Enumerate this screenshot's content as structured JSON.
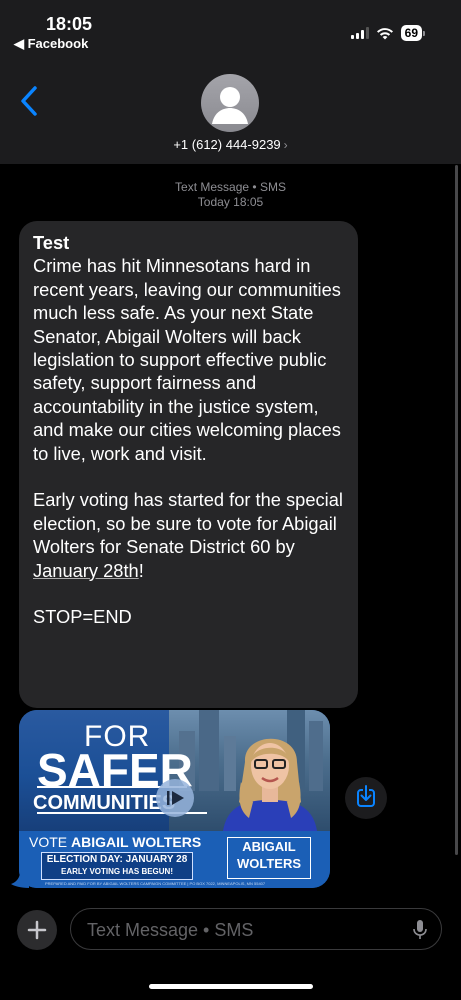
{
  "status_bar": {
    "time": "18:05",
    "back_app": "◀ Facebook",
    "battery": "69"
  },
  "header": {
    "contact": "+1 (612) 444-9239",
    "contact_chevron": "›"
  },
  "thread": {
    "service": "Text Message • SMS",
    "timestamp": "Today 18:05"
  },
  "message": {
    "subject": "Test",
    "paragraph1": "Crime has hit Minnesotans hard in recent years, leaving our communities much less safe. As your next State Senator, Abigail Wolters will back legislation to support effective public safety, support fairness and accountability in the justice system, and make our cities welcoming places to live, work and visit.",
    "paragraph2_pre": "Early voting has started for the special election, so be sure to vote for Abigail Wolters for Senate District 60 by ",
    "paragraph2_link": "January 28th",
    "paragraph2_post": "!",
    "stop": "STOP=END"
  },
  "attachment": {
    "line1": "FOR",
    "line2": "SAFER",
    "line3": "COMMUNITIES",
    "vote_prefix": "VOTE ",
    "vote_name": "ABIGAIL WOLTERS",
    "election_day": "ELECTION DAY: JANUARY 28",
    "early_voting": "EARLY VOTING HAS BEGUN!",
    "badge_line1": "ABIGAIL",
    "badge_line2": "WOLTERS",
    "fine_print": "PREPARED AND PAID FOR BY ABIGAIL WOLTERS CAMPAIGN COMMITTEE | PO BOX 7022, MINNEAPOLIS, MN 55407"
  },
  "composer": {
    "placeholder": "Text Message • SMS"
  },
  "colors": {
    "accent": "#0a84ff",
    "bubble": "#262628",
    "background": "#000000",
    "flyer_blue": "#1b5fb6"
  },
  "icons": {
    "back": "chevron-left-icon",
    "save": "save-to-device-icon",
    "play": "play-icon",
    "plus": "plus-icon",
    "mic": "microphone-icon"
  }
}
